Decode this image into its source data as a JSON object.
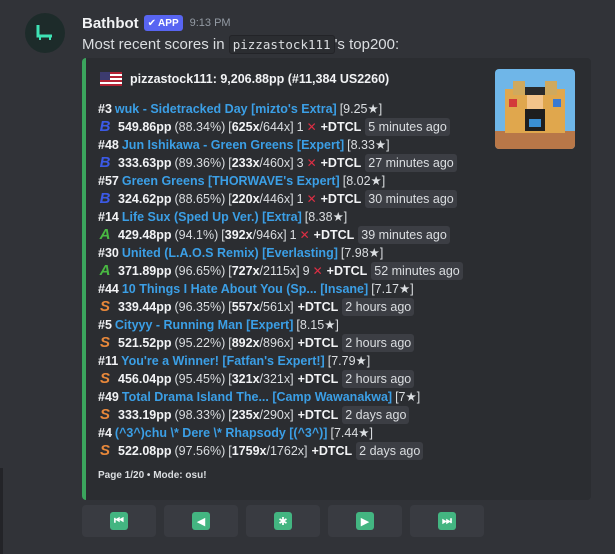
{
  "message": {
    "username": "Bathbot",
    "app_badge": "APP",
    "timestamp": "9:13 PM",
    "content_prefix": "Most recent scores in ",
    "content_user": "pizzastock111",
    "content_suffix": "'s top200:"
  },
  "embed": {
    "accent_color": "#3ba55d",
    "author": "pizzastock111: 9,206.88pp (#11,384 US2260)",
    "flag_icon": "us-flag-icon",
    "thumbnail_icon": "roblox-avatar-image",
    "scores": [
      {
        "rank": "#3",
        "beatmap": "wuk - Sidetracked Day [mizto's Extra]",
        "stars": "[9.25★]",
        "grade": "B",
        "pp": "549.86pp",
        "acc": "(88.34%)",
        "combo_max": "625x",
        "combo_total": "/644x]",
        "misses": "1",
        "mods": "+DTCL",
        "ago": "5 minutes ago"
      },
      {
        "rank": "#48",
        "beatmap": "Jun Ishikawa - Green Greens [Expert]",
        "stars": "[8.33★]",
        "grade": "B",
        "pp": "333.63pp",
        "acc": "(89.36%)",
        "combo_max": "233x",
        "combo_total": "/460x]",
        "misses": "3",
        "mods": "+DTCL",
        "ago": "27 minutes ago"
      },
      {
        "rank": "#57",
        "beatmap": "Green Greens [THORWAVE's Expert]",
        "stars": "[8.02★]",
        "grade": "B",
        "pp": "324.62pp",
        "acc": "(88.65%)",
        "combo_max": "220x",
        "combo_total": "/446x]",
        "misses": "1",
        "mods": "+DTCL",
        "ago": "30 minutes ago"
      },
      {
        "rank": "#14",
        "beatmap": "Life Sux (Sped Up Ver.) [Extra]",
        "stars": "[8.38★]",
        "grade": "A",
        "pp": "429.48pp",
        "acc": "(94.1%)",
        "combo_max": "392x",
        "combo_total": "/946x]",
        "misses": "1",
        "mods": "+DTCL",
        "ago": "39 minutes ago"
      },
      {
        "rank": "#30",
        "beatmap": "United (L.A.O.S Remix) [Everlasting]",
        "stars": "[7.98★]",
        "grade": "A",
        "pp": "371.89pp",
        "acc": "(96.65%)",
        "combo_max": "727x",
        "combo_total": "/2115x]",
        "misses": "9",
        "mods": "+DTCL",
        "ago": "52 minutes ago"
      },
      {
        "rank": "#44",
        "beatmap": "10 Things I Hate About You (Sp... [Insane]",
        "stars": "[7.17★]",
        "grade": "S",
        "pp": "339.44pp",
        "acc": "(96.35%)",
        "combo_max": "557x",
        "combo_total": "/561x]",
        "misses": "",
        "mods": "+DTCL",
        "ago": "2 hours ago"
      },
      {
        "rank": "#5",
        "beatmap": "Cityyy - Running Man [Expert]",
        "stars": "[8.15★]",
        "grade": "S",
        "pp": "521.52pp",
        "acc": "(95.22%)",
        "combo_max": "892x",
        "combo_total": "/896x]",
        "misses": "",
        "mods": "+DTCL",
        "ago": "2 hours ago"
      },
      {
        "rank": "#11",
        "beatmap": "You're a Winner! [Fatfan's Expert!]",
        "stars": "[7.79★]",
        "grade": "S",
        "pp": "456.04pp",
        "acc": "(95.45%)",
        "combo_max": "321x",
        "combo_total": "/321x]",
        "misses": "",
        "mods": "+DTCL",
        "ago": "2 hours ago"
      },
      {
        "rank": "#49",
        "beatmap": "Total Drama Island The... [Camp Wawanakwa]",
        "stars": "[7★]",
        "grade": "S",
        "pp": "333.19pp",
        "acc": "(98.33%)",
        "combo_max": "235x",
        "combo_total": "/290x]",
        "misses": "",
        "mods": "+DTCL",
        "ago": "2 days ago"
      },
      {
        "rank": "#4",
        "beatmap": "(^3^)chu \\* Dere \\* Rhapsody [(^3^)]",
        "stars": "[7.44★]",
        "grade": "S",
        "pp": "522.08pp",
        "acc": "(97.56%)",
        "combo_max": "1759x",
        "combo_total": "/1762x]",
        "misses": "",
        "mods": "+DTCL",
        "ago": "2 days ago"
      }
    ],
    "footer": "Page 1/20 • Mode: osu!"
  },
  "buttons": [
    {
      "name": "first-page",
      "icon": "⏮"
    },
    {
      "name": "previous-page",
      "icon": "◀"
    },
    {
      "name": "jump-page",
      "icon": "✱"
    },
    {
      "name": "next-page",
      "icon": "▶"
    },
    {
      "name": "last-page",
      "icon": "⏭"
    }
  ]
}
